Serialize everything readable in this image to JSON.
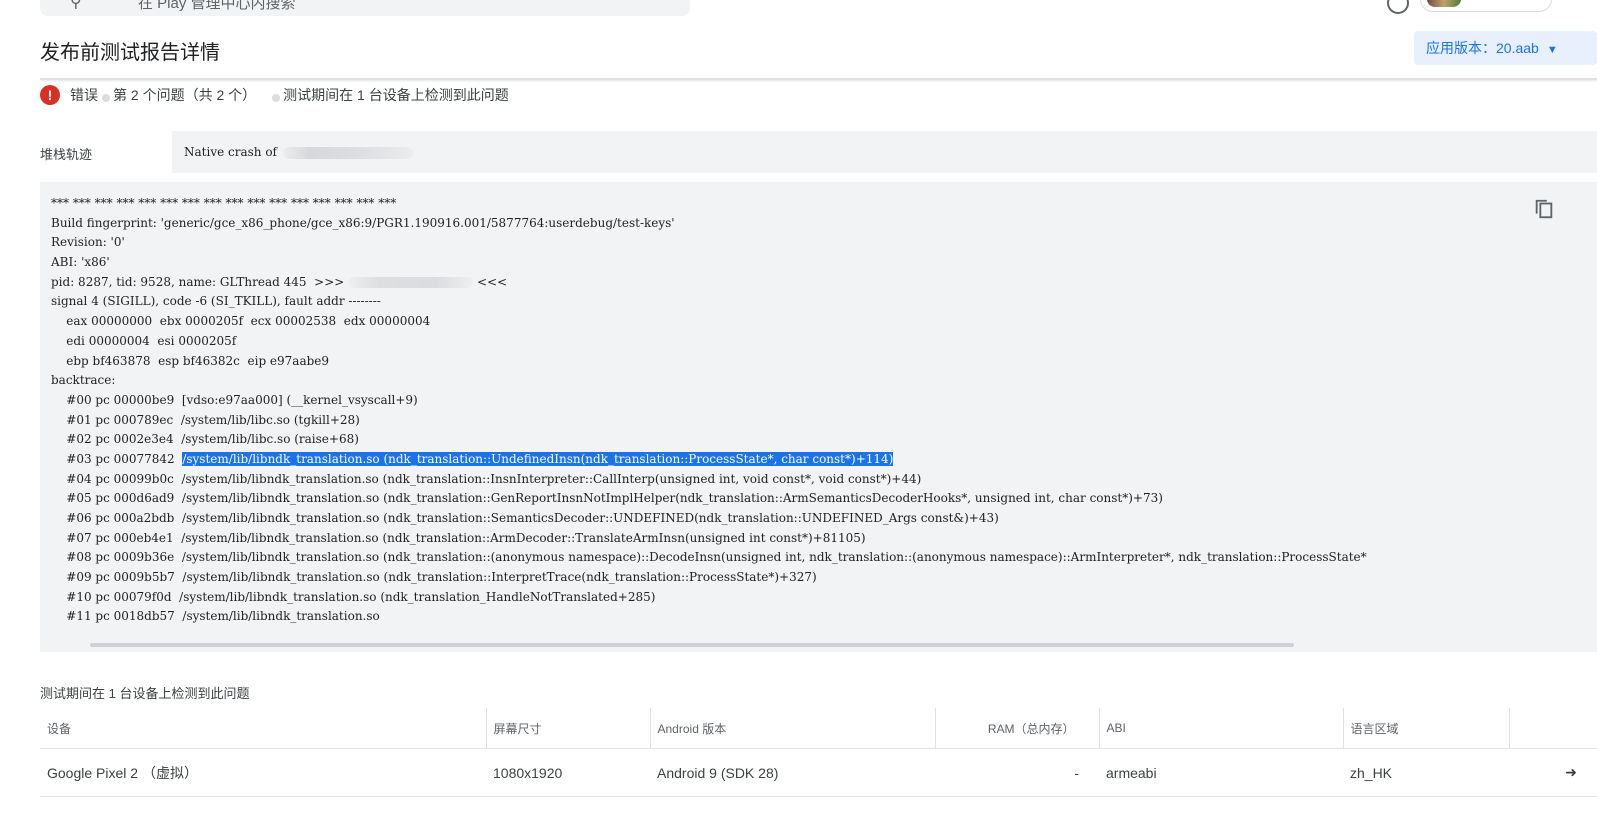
{
  "header": {
    "search_placeholder": "在 Play 管理中心内搜索",
    "page_title": "发布前测试报告详情",
    "version_label": "应用版本：20.aab"
  },
  "status": {
    "severity": "错误",
    "issue_position": "第 2 个问题（共 2 个）",
    "device_summary": "测试期间在 1 台设备上检测到此问题"
  },
  "stack": {
    "label": "堆栈轨迹",
    "header_text": "Native crash of",
    "lines": [
      "*** *** *** *** *** *** *** *** *** *** *** *** *** *** *** ***",
      "Build fingerprint: 'generic/gce_x86_phone/gce_x86:9/PGR1.190916.001/5877764:userdebug/test-keys'",
      "Revision: '0'",
      "ABI: 'x86'",
      "pid: 8287, tid: 9528, name: GLThread 445  >>> ",
      "signal 4 (SIGILL), code -6 (SI_TKILL), fault addr --------",
      "    eax 00000000  ebx 0000205f  ecx 00002538  edx 00000004",
      "    edi 00000004  esi 0000205f",
      "    ebp bf463878  esp bf46382c  eip e97aabe9",
      "backtrace:",
      "    #00 pc 00000be9  [vdso:e97aa000] (__kernel_vsyscall+9)",
      "    #01 pc 000789ec  /system/lib/libc.so (tgkill+28)",
      "    #02 pc 0002e3e4  /system/lib/libc.so (raise+68)",
      "    #03 pc 00077842  ",
      "    #04 pc 00099b0c  /system/lib/libndk_translation.so (ndk_translation::InsnInterpreter::CallInterp(unsigned int, void const*, void const*)+44)",
      "    #05 pc 000d6ad9  /system/lib/libndk_translation.so (ndk_translation::GenReportInsnNotImplHelper(ndk_translation::ArmSemanticsDecoderHooks*, unsigned int, char const*)+73)",
      "    #06 pc 000a2bdb  /system/lib/libndk_translation.so (ndk_translation::SemanticsDecoder::UNDEFINED(ndk_translation::UNDEFINED_Args const&)+43)",
      "    #07 pc 000eb4e1  /system/lib/libndk_translation.so (ndk_translation::ArmDecoder::TranslateArmInsn(unsigned int const*)+81105)",
      "    #08 pc 0009b36e  /system/lib/libndk_translation.so (ndk_translation::(anonymous namespace)::DecodeInsn(unsigned int, ndk_translation::(anonymous namespace)::ArmInterpreter*, ndk_translation::ProcessState*",
      "    #09 pc 0009b5b7  /system/lib/libndk_translation.so (ndk_translation::InterpretTrace(ndk_translation::ProcessState*)+327)",
      "    #10 pc 00079f0d  /system/lib/libndk_translation.so (ndk_translation_HandleNotTranslated+285)",
      "    #11 pc 0018db57  /system/lib/libndk_translation.so"
    ],
    "pid_suffix": "<<<",
    "highlighted_text": "/system/lib/libndk_translation.so (ndk_translation::UndefinedInsn(ndk_translation::ProcessState*, char const*)+114)"
  },
  "devices": {
    "title": "测试期间在 1 台设备上检测到此问题",
    "columns": [
      "设备",
      "屏幕尺寸",
      "Android 版本",
      "RAM（总内存）",
      "ABI",
      "语言区域"
    ],
    "rows": [
      {
        "device": "Google Pixel 2 （虚拟）",
        "screen": "1080x1920",
        "android": "Android 9 (SDK 28)",
        "ram": "-",
        "abi": "armeabi",
        "locale": "zh_HK"
      }
    ]
  },
  "icons": {
    "error": "error-icon",
    "copy": "copy-icon",
    "arrow": "arrow-right-icon",
    "search": "search-icon",
    "help": "help-icon"
  },
  "colors": {
    "accent": "#1a73e8",
    "error": "#d93025",
    "code_bg": "#f1f3f4"
  }
}
